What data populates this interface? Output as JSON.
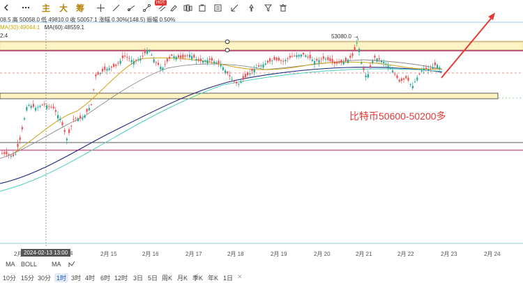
{
  "toolbar": {
    "tabs": [
      "主",
      "大",
      "筹"
    ],
    "hot_badge": "HOT"
  },
  "info": {
    "ohlc": "08.5  高 50058.0  低 49810.0  收 50057.1  涨幅 0.30%(148.5)  振幅 0.50%",
    "ma_line": [
      {
        "text": "MA(30):49044.1",
        "color": "#c8a800"
      },
      {
        "text": "MA(60):48559.1",
        "color": "#333333"
      }
    ],
    "scale_fragment": "2.4"
  },
  "chart": {
    "peak_label": "53080.0",
    "annotation": "比特币50600-50200多",
    "x_labels": [
      "2月",
      "2月 15",
      "2月 16",
      "2月 17",
      "2月 18",
      "2月 19",
      "2月 20",
      "2月 21",
      "2月 22",
      "2月 23",
      "2月 24"
    ],
    "x_label_fragment": "4",
    "crosshair_date": "2024-02-13 13:00",
    "colors": {
      "up": "#26a69a",
      "down": "#ef5350",
      "accent": "#e53935",
      "zone": "#fff3c4"
    }
  },
  "indicators": [
    "MA",
    "BOLL",
    "MA"
  ],
  "timeframes": [
    "10分",
    "15分",
    "30分",
    "1时",
    "3时",
    "4时",
    "6时",
    "12时",
    "3日",
    "5日",
    "周K",
    "月K",
    "季K",
    "年K",
    "1日"
  ],
  "active_timeframe": "1时"
}
